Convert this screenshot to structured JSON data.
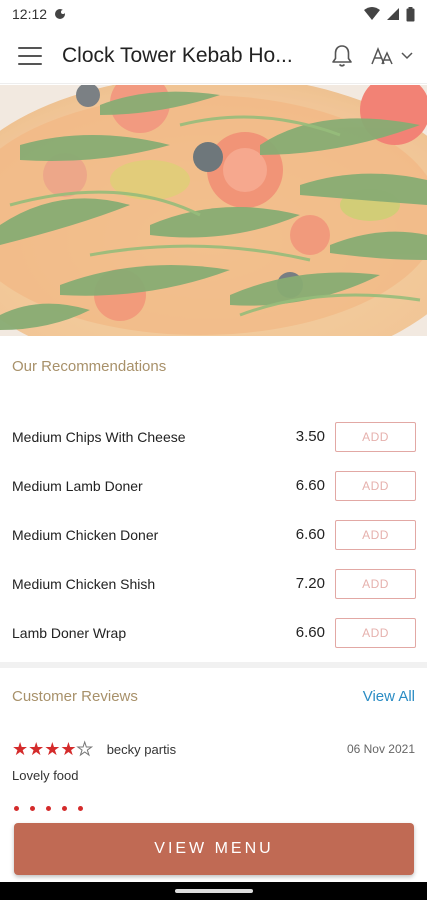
{
  "status_bar": {
    "time": "12:12"
  },
  "app_bar": {
    "title": "Clock Tower Kebab Ho..."
  },
  "recommendations": {
    "title": "Our Recommendations",
    "add_label": "ADD",
    "items": [
      {
        "name": "Medium Chips With Cheese",
        "price": "3.50"
      },
      {
        "name": "Medium Lamb Doner",
        "price": "6.60"
      },
      {
        "name": "Medium Chicken Doner",
        "price": "6.60"
      },
      {
        "name": "Medium Chicken Shish",
        "price": "7.20"
      },
      {
        "name": "Lamb Doner Wrap",
        "price": "6.60"
      }
    ]
  },
  "reviews": {
    "title": "Customer Reviews",
    "view_all": "View All",
    "items": [
      {
        "rating": 4,
        "max": 5,
        "reviewer": "becky partis",
        "date": "06 Nov 2021",
        "text": "Lovely food"
      }
    ]
  },
  "footer": {
    "view_menu_label": "VIEW MENU"
  },
  "colors": {
    "accent": "#c06a54",
    "section_title": "#a8916a",
    "link": "#2a8cc4",
    "star": "#d42b2b",
    "add_border": "#e2a8a4"
  },
  "icons": {
    "menu": "hamburger-icon",
    "notifications": "bell-icon",
    "language": "translate-icon",
    "dropdown": "chevron-down-icon"
  }
}
